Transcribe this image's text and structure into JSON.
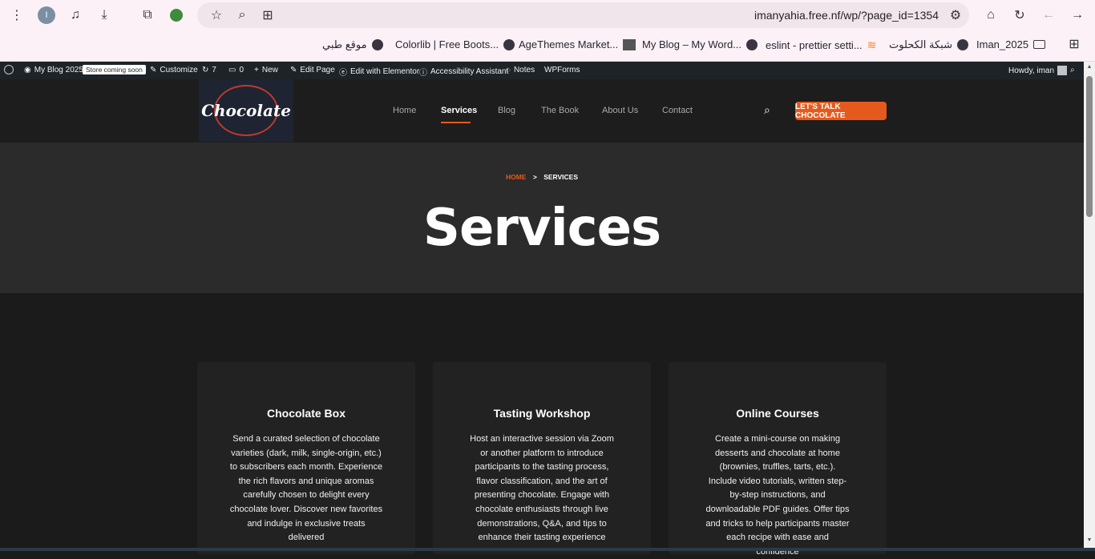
{
  "browser": {
    "url": "imanyahia.free.nf/wp/?page_id=1354",
    "profile_initial": "I"
  },
  "bookmarks": [
    "Colorlib | Free Boots...",
    "AgeThemes Market...",
    "My Blog – My Word...",
    "eslint - prettier setti...",
    "شبكة الكحلوت",
    "Iman_2025",
    "موقع طبي"
  ],
  "wpbar": {
    "site": "My Blog 2025",
    "badge": "Store coming soon",
    "customize": "Customize",
    "updates": "7",
    "comments": "0",
    "new": "New",
    "edit_page": "Edit Page",
    "elementor": "Edit with Elementor",
    "accessibility": "Accessibility Assistant",
    "notes": "Notes",
    "wpforms": "WPForms",
    "howdy": "Howdy, iman"
  },
  "logo": {
    "text": "Chocolate"
  },
  "nav": {
    "items": [
      "Home",
      "Services",
      "Blog",
      "The Book",
      "About Us",
      "Contact"
    ],
    "active": "Services",
    "cta": "LET'S TALK CHOCOLATE"
  },
  "hero": {
    "breadcrumb_home": "HOME",
    "breadcrumb_sep": ">",
    "breadcrumb_current": "SERVICES",
    "title": "Services"
  },
  "cards": [
    {
      "title": "Chocolate Box",
      "text": "Send a curated selection of chocolate varieties (dark, milk, single-origin, etc.) to subscribers each month. Experience the rich flavors and unique aromas carefully chosen to delight every chocolate lover. Discover new favorites and indulge in exclusive treats delivered"
    },
    {
      "title": "Tasting Workshop",
      "text": "Host an interactive session via Zoom or another platform to introduce participants to the tasting process, flavor classification, and the art of presenting chocolate. Engage with chocolate enthusiasts through live demonstrations, Q&A, and tips to enhance their tasting experience"
    },
    {
      "title": "Online Courses",
      "text": "Create a mini-course on making desserts and chocolate at home (brownies, truffles, tarts, etc.). Include video tutorials, written step-by-step instructions, and downloadable PDF guides. Offer tips and tricks to help participants master each recipe with ease and confidence"
    }
  ],
  "colors": {
    "accent": "#e55a1c",
    "dark": "#1b1b1b",
    "hero": "#2b2b2b"
  }
}
